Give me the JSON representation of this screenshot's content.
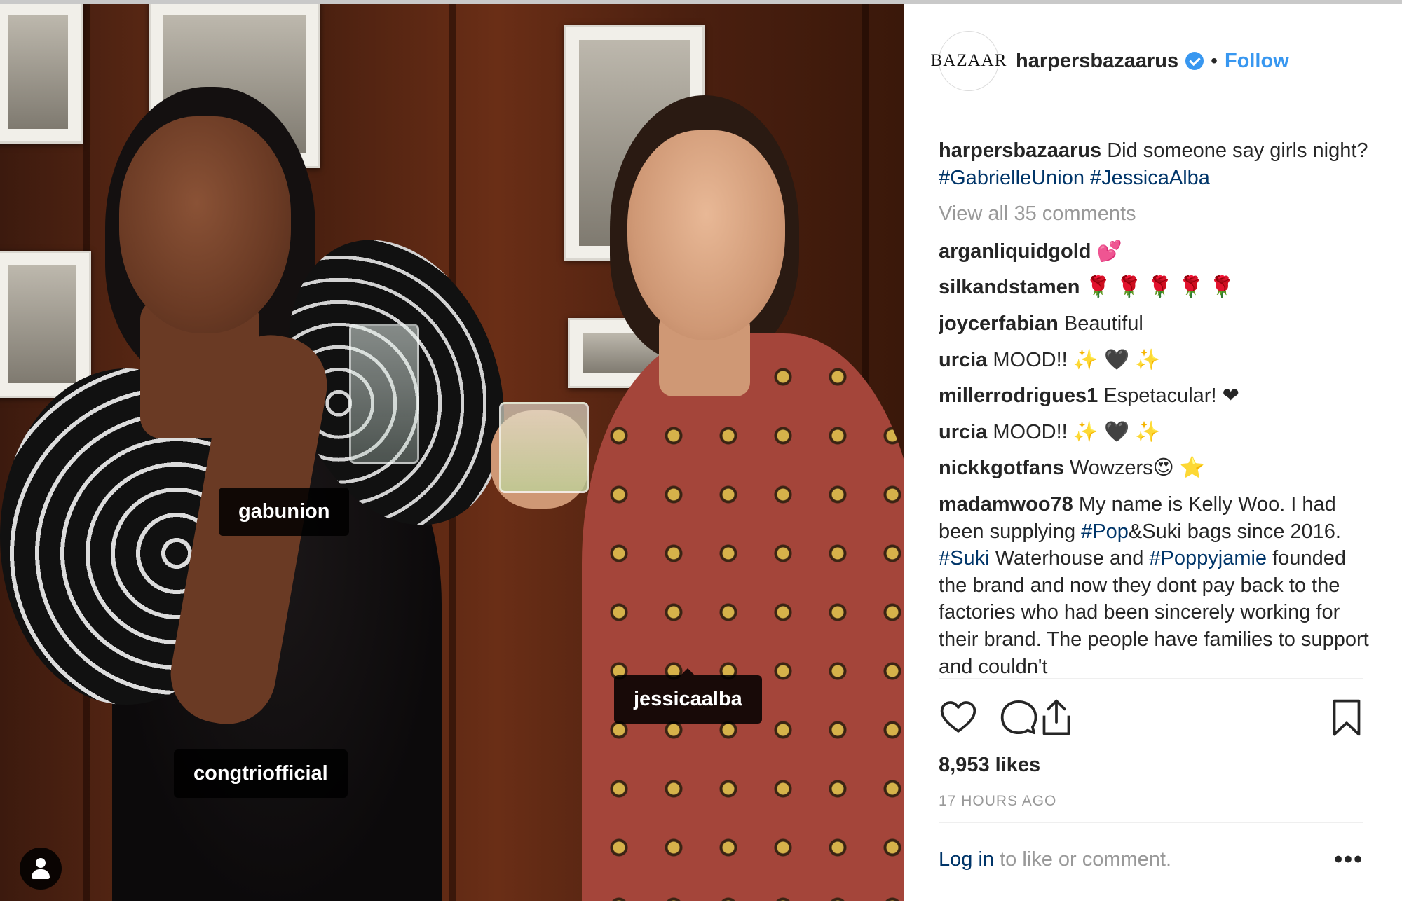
{
  "post": {
    "tags": {
      "gabunion": "gabunion",
      "jessicaalba": "jessicaalba",
      "congtri": "congtriofficial"
    }
  },
  "header": {
    "avatar_text": "BAZAAR",
    "handle": "harpersbazaarus",
    "separator": "•",
    "follow_label": "Follow"
  },
  "caption": {
    "user": "harpersbazaarus",
    "text": "Did someone say girls night?",
    "hashtags": [
      "#GabrielleUnion",
      "#JessicaAlba"
    ]
  },
  "view_all_label": "View all 35 comments",
  "comments": [
    {
      "user": "arganliquidgold",
      "text": "💕"
    },
    {
      "user": "silkandstamen",
      "text": "🌹 🌹 🌹 🌹 🌹"
    },
    {
      "user": "joycerfabian",
      "text": "Beautiful"
    },
    {
      "user": "urcia",
      "text": "MOOD!! ✨ 🖤 ✨"
    },
    {
      "user": "millerrodrigues1",
      "text": "Espetacular! ❤"
    },
    {
      "user": "urcia",
      "text": "MOOD!! ✨ 🖤 ✨"
    },
    {
      "user": "nickkgotfans",
      "text": "Wowzers😍 ⭐"
    }
  ],
  "long_comment": {
    "user": "madamwoo78",
    "t1": "My name is Kelly Woo. I had been supplying",
    "h1": "#Pop",
    "t2": "&Suki bags since 2016.",
    "h2": "#Suki",
    "t3": "Waterhouse and",
    "h3": "#Poppyjamie",
    "t4": "founded the brand and now they dont pay back to the factories who had been sincerely working for their brand. The people have families to support and couldn't"
  },
  "likes": "8,953 likes",
  "timestamp": "17 HOURS AGO",
  "login": {
    "link": "Log in",
    "rest": "to like or comment.",
    "more": "•••"
  },
  "icons": {
    "heart": "heart-icon",
    "comment": "comment-icon",
    "share": "share-icon",
    "bookmark": "bookmark-icon",
    "user": "user-icon",
    "verified": "verified-badge-icon"
  },
  "colors": {
    "accent": "#3897f0",
    "hashtag": "#003569",
    "muted": "#999999",
    "text": "#262626"
  }
}
